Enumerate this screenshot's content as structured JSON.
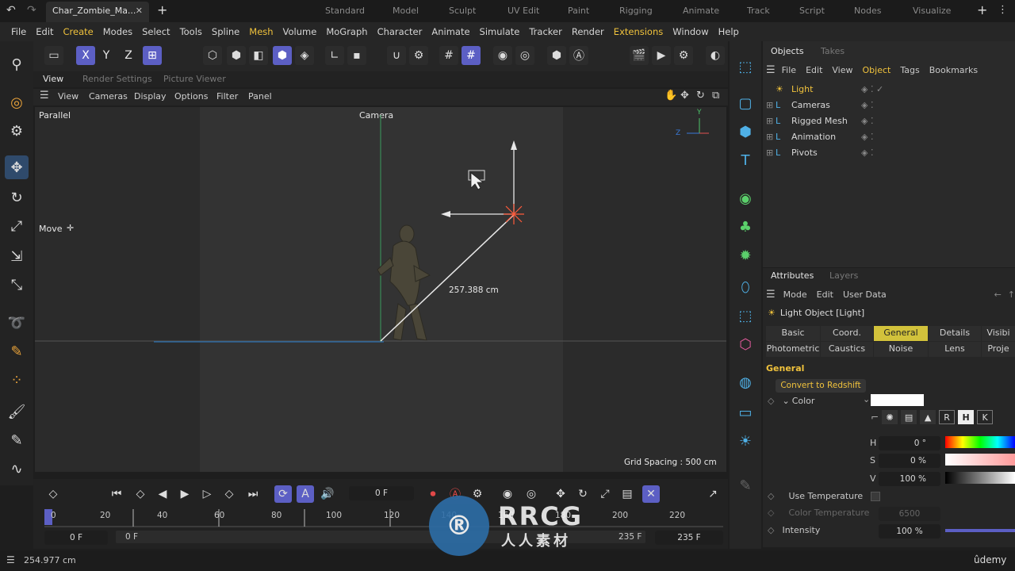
{
  "titlebar": {
    "doc_tab": "Char_Zombie_Ma...",
    "layouts": [
      "Standard",
      "Model",
      "Sculpt",
      "UV Edit",
      "Paint",
      "Rigging",
      "Animate",
      "Track",
      "Script",
      "Nodes",
      "Visualize"
    ]
  },
  "menu": [
    "File",
    "Edit",
    "Create",
    "Modes",
    "Select",
    "Tools",
    "Spline",
    "Mesh",
    "Volume",
    "MoGraph",
    "Character",
    "Animate",
    "Simulate",
    "Tracker",
    "Render",
    "Extensions",
    "Window",
    "Help"
  ],
  "axis_buttons": {
    "x": "X",
    "y": "Y",
    "z": "Z"
  },
  "viewport_tabs": {
    "view": "View",
    "render_settings": "Render Settings",
    "picture_viewer": "Picture Viewer"
  },
  "viewport_menu": {
    "view": "View",
    "cameras": "Cameras",
    "display": "Display",
    "options": "Options",
    "filter": "Filter",
    "panel": "Panel"
  },
  "viewport": {
    "projection": "Parallel",
    "camera": "Camera",
    "tool": "Move",
    "measure": "257.388 cm",
    "grid_spacing": "Grid Spacing : 500 cm",
    "axis_y": "Y",
    "axis_z": "Z"
  },
  "objects_panel": {
    "tabs": {
      "objects": "Objects",
      "takes": "Takes"
    },
    "menu": {
      "file": "File",
      "edit": "Edit",
      "view": "View",
      "object": "Object",
      "tags": "Tags",
      "bookmarks": "Bookmarks"
    },
    "items": [
      "Light",
      "Cameras",
      "Rigged Mesh",
      "Animation",
      "Pivots"
    ]
  },
  "attributes_panel": {
    "tabs": {
      "attributes": "Attributes",
      "layers": "Layers"
    },
    "menu": {
      "mode": "Mode",
      "edit": "Edit",
      "user_data": "User Data"
    },
    "object_title": "Light Object [Light]",
    "tabs_row1": [
      "Basic",
      "Coord.",
      "General",
      "Details",
      "Visibi"
    ],
    "tabs_row2": [
      "Photometric",
      "Caustics",
      "Noise",
      "Lens",
      "Proje"
    ],
    "section": "General",
    "convert_button": "Convert to Redshift",
    "color_label": "Color",
    "channel_buttons": {
      "r": "R",
      "h": "H",
      "k": "K"
    },
    "hsv": [
      {
        "label": "H",
        "value": "0 °"
      },
      {
        "label": "S",
        "value": "0 %"
      },
      {
        "label": "V",
        "value": "100 %"
      }
    ],
    "use_temperature": "Use Temperature",
    "color_temperature": "Color Temperature",
    "color_temperature_value": "6500",
    "intensity": "Intensity",
    "intensity_value": "100 %"
  },
  "timeline": {
    "current_frame": "0 F",
    "ticks": [
      "0",
      "20",
      "40",
      "60",
      "80",
      "100",
      "120",
      "140",
      "160",
      "180",
      "200",
      "220"
    ],
    "start_frame": "0 F",
    "preview_start": "0 F",
    "end_frame": "235 F",
    "max_frame": "235 F"
  },
  "status": {
    "coord": "254.977 cm",
    "brand": "ûdemy"
  },
  "watermark": {
    "text": "RRCG",
    "sub": "人人素材"
  },
  "colors": {
    "accent_blue": "#5c5fc4",
    "highlight_yellow": "#f0c23c",
    "tab_active": "#d2c23b"
  }
}
